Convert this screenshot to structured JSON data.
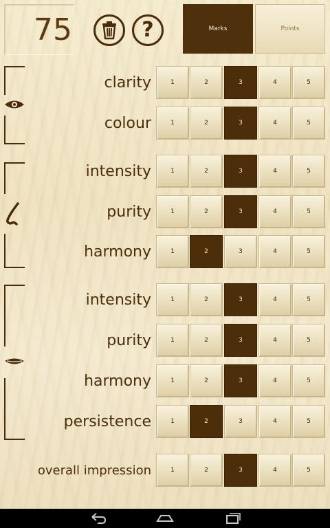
{
  "header": {
    "score": "75",
    "help_glyph": "?",
    "modes": [
      {
        "label": "Marks",
        "selected": true
      },
      {
        "label": "Points",
        "selected": false
      }
    ]
  },
  "icons": {
    "trash": "trash-icon",
    "help": "help-icon",
    "eye": "eye-icon",
    "nose": "nose-icon",
    "mouth": "mouth-icon",
    "back": "back-icon",
    "home": "home-icon",
    "recents": "recents-icon"
  },
  "colors": {
    "selected": "#4c2e0a",
    "text": "#4b2e0b",
    "wood": "#f0e6c8"
  },
  "rows": [
    {
      "label": "clarity",
      "buttons": [
        "1",
        "2",
        "3",
        "4",
        "5"
      ],
      "selected": 3
    },
    {
      "label": "colour",
      "buttons": [
        "1",
        "2",
        "3",
        "4",
        "5"
      ],
      "selected": 3
    },
    {
      "label": "intensity",
      "buttons": [
        "1",
        "2",
        "3",
        "4",
        "5"
      ],
      "selected": 3
    },
    {
      "label": "purity",
      "buttons": [
        "1",
        "2",
        "3",
        "4",
        "5"
      ],
      "selected": 3
    },
    {
      "label": "harmony",
      "buttons": [
        "1",
        "2",
        "3",
        "4",
        "5"
      ],
      "selected": 2
    },
    {
      "label": "intensity",
      "buttons": [
        "1",
        "2",
        "3",
        "4",
        "5"
      ],
      "selected": 3
    },
    {
      "label": "purity",
      "buttons": [
        "1",
        "2",
        "3",
        "4",
        "5"
      ],
      "selected": 3
    },
    {
      "label": "harmony",
      "buttons": [
        "1",
        "2",
        "3",
        "4",
        "5"
      ],
      "selected": 3
    },
    {
      "label": "persistence",
      "buttons": [
        "1",
        "2",
        "3",
        "4",
        "5"
      ],
      "selected": 2
    },
    {
      "label": "overall impression",
      "buttons": [
        "1",
        "2",
        "3",
        "4",
        "5"
      ],
      "selected": 3
    }
  ]
}
